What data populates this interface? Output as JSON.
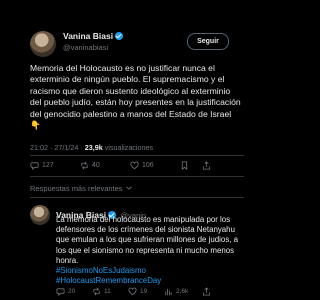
{
  "tweet": {
    "name": "Vanina Biasi",
    "handle": "@vaninabiasi",
    "follow_label": "Seguir",
    "text": "Memoria del Holocausto es no justificar nunca el exterminio de ningún pueblo. El supremacismo y el racismo que dieron sustento ideológico al exterminio del pueblo judío, están hoy presentes en la justificación del genocidio palestino a manos del Estado de Israel 👇",
    "time": "21:02 · 27/1/24 · ",
    "views": "23,9k",
    "views_label": " visualizaciones",
    "stats": {
      "replies": "127",
      "reposts": "40",
      "likes": "106"
    }
  },
  "replies_header": "Respuestas más relevantes",
  "reply": {
    "name": "Vanina Biasi",
    "handle": "@vanin",
    "text": "La memoria del holocausto es manipulada por los defensores de los crímenes del sionista Netanyahu que emulan a los que sufrieran millones de judios, a los que el sionismo no representa ni mucho menos honra.",
    "hashtag1": "#SionismoNoEsJudaismo",
    "hashtag2": "#HolocaustRemembranceDay",
    "stats": {
      "replies": "20",
      "reposts": "11",
      "likes": "19",
      "views": "2,6k"
    }
  },
  "colors": {
    "accent": "#1d9bf0",
    "background": "#000000",
    "muted": "#71767b"
  }
}
